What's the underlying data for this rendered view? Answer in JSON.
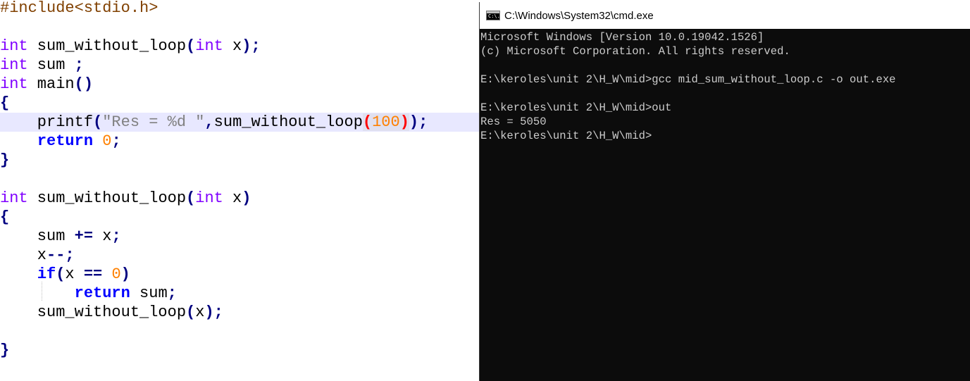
{
  "editor": {
    "lines": [
      [
        {
          "t": "#include<stdio.h>",
          "c": "tok-pre"
        }
      ],
      [],
      [
        {
          "t": "int",
          "c": "tok-type"
        },
        {
          "t": " sum_without_loop",
          "c": "tok-plain"
        },
        {
          "t": "(",
          "c": "tok-op"
        },
        {
          "t": "int",
          "c": "tok-type"
        },
        {
          "t": " x",
          "c": "tok-plain"
        },
        {
          "t": ");",
          "c": "tok-op"
        }
      ],
      [
        {
          "t": "int",
          "c": "tok-type"
        },
        {
          "t": " sum ",
          "c": "tok-plain"
        },
        {
          "t": ";",
          "c": "tok-op"
        }
      ],
      [
        {
          "t": "int",
          "c": "tok-type"
        },
        {
          "t": " main",
          "c": "tok-plain"
        },
        {
          "t": "()",
          "c": "tok-op"
        }
      ],
      [
        {
          "t": "{",
          "c": "tok-brace"
        }
      ],
      [
        {
          "t": "    printf",
          "c": "tok-plain"
        },
        {
          "t": "(",
          "c": "tok-op"
        },
        {
          "t": "\"Res = %d \"",
          "c": "tok-str"
        },
        {
          "t": ",",
          "c": "tok-op"
        },
        {
          "t": "sum_without_loop",
          "c": "tok-plain"
        },
        {
          "t": "(",
          "c": "tok-paren-hl"
        },
        {
          "t": "100",
          "c": "tok-num-hl"
        },
        {
          "t": ")",
          "c": "tok-paren-hl"
        },
        {
          "t": ");",
          "c": "tok-op"
        }
      ],
      [
        {
          "t": "    ",
          "c": "tok-plain"
        },
        {
          "t": "return",
          "c": "tok-kw"
        },
        {
          "t": " ",
          "c": "tok-plain"
        },
        {
          "t": "0",
          "c": "tok-num"
        },
        {
          "t": ";",
          "c": "tok-op"
        }
      ],
      [
        {
          "t": "}",
          "c": "tok-brace"
        }
      ],
      [],
      [
        {
          "t": "int",
          "c": "tok-type"
        },
        {
          "t": " sum_without_loop",
          "c": "tok-plain"
        },
        {
          "t": "(",
          "c": "tok-op"
        },
        {
          "t": "int",
          "c": "tok-type"
        },
        {
          "t": " x",
          "c": "tok-plain"
        },
        {
          "t": ")",
          "c": "tok-op"
        }
      ],
      [
        {
          "t": "{",
          "c": "tok-brace"
        }
      ],
      [
        {
          "t": "    sum ",
          "c": "tok-plain"
        },
        {
          "t": "+=",
          "c": "tok-op"
        },
        {
          "t": " x",
          "c": "tok-plain"
        },
        {
          "t": ";",
          "c": "tok-op"
        }
      ],
      [
        {
          "t": "    x",
          "c": "tok-plain"
        },
        {
          "t": "--;",
          "c": "tok-op"
        }
      ],
      [
        {
          "t": "    ",
          "c": "tok-plain"
        },
        {
          "t": "if",
          "c": "tok-kw"
        },
        {
          "t": "(",
          "c": "tok-op"
        },
        {
          "t": "x ",
          "c": "tok-plain"
        },
        {
          "t": "==",
          "c": "tok-op"
        },
        {
          "t": " ",
          "c": "tok-plain"
        },
        {
          "t": "0",
          "c": "tok-num"
        },
        {
          "t": ")",
          "c": "tok-op"
        }
      ],
      [
        {
          "t": "        ",
          "c": "tok-plain"
        },
        {
          "t": "return",
          "c": "tok-kw"
        },
        {
          "t": " sum",
          "c": "tok-plain"
        },
        {
          "t": ";",
          "c": "tok-op"
        }
      ],
      [
        {
          "t": "    sum_without_loop",
          "c": "tok-plain"
        },
        {
          "t": "(",
          "c": "tok-op"
        },
        {
          "t": "x",
          "c": "tok-plain"
        },
        {
          "t": ");",
          "c": "tok-op"
        }
      ],
      [],
      [
        {
          "t": "}",
          "c": "tok-brace"
        }
      ]
    ]
  },
  "console": {
    "title": "C:\\Windows\\System32\\cmd.exe",
    "icon": "cmd-window-icon",
    "icon_glyph": "C:\\.",
    "lines": [
      "Microsoft Windows [Version 10.0.19042.1526]",
      "(c) Microsoft Corporation. All rights reserved.",
      "",
      "E:\\keroles\\unit 2\\H_W\\mid>gcc mid_sum_without_loop.c -o out.exe",
      "",
      "E:\\keroles\\unit 2\\H_W\\mid>out",
      "Res = 5050",
      "E:\\keroles\\unit 2\\H_W\\mid>"
    ]
  },
  "colors": {
    "editor_bg": "#ffffff",
    "current_line": "#e8e8ff",
    "console_bg": "#0c0c0c",
    "console_text": "#cccccc"
  }
}
